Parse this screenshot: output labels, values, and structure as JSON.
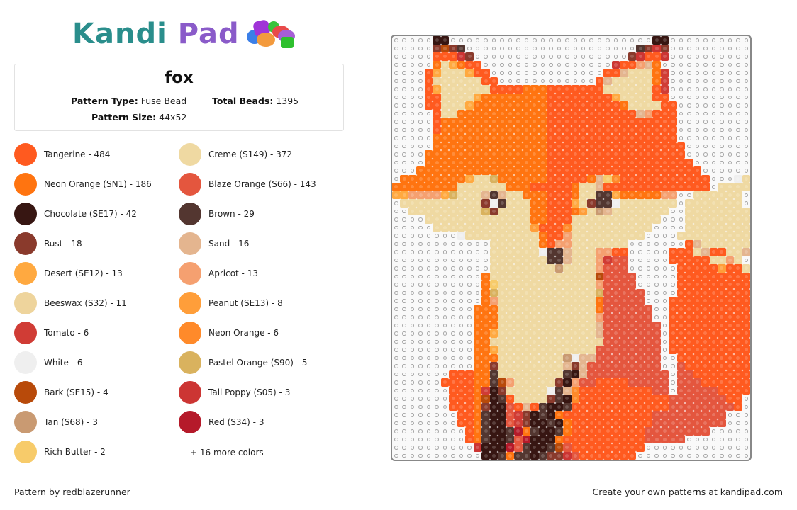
{
  "brand": {
    "part1": "Kandi",
    "part2": "Pad"
  },
  "pattern": {
    "title": "fox",
    "type_label": "Pattern Type:",
    "type_value": "Fuse Bead",
    "beads_label": "Total Beads:",
    "beads_value": "1395",
    "size_label": "Pattern Size:",
    "size_value": "44x52"
  },
  "colors": [
    {
      "name": "Tangerine - 484",
      "hex": "#FF5A1F",
      "code": "T"
    },
    {
      "name": "Creme (S149) - 372",
      "hex": "#EFD9A2",
      "code": "C"
    },
    {
      "name": "Neon Orange (SN1) - 186",
      "hex": "#FF7410",
      "code": "N"
    },
    {
      "name": "Blaze Orange (S66) - 143",
      "hex": "#E4563E",
      "code": "B"
    },
    {
      "name": "Chocolate (SE17) - 42",
      "hex": "#371612",
      "code": "K"
    },
    {
      "name": "Brown - 29",
      "hex": "#533630",
      "code": "W"
    },
    {
      "name": "Rust - 18",
      "hex": "#8A3A2C",
      "code": "R"
    },
    {
      "name": "Sand - 16",
      "hex": "#E4B58F",
      "code": "S"
    },
    {
      "name": "Desert (SE12) - 13",
      "hex": "#FFA940",
      "code": "D"
    },
    {
      "name": "Apricot - 13",
      "hex": "#F5A070",
      "code": "A"
    },
    {
      "name": "Beeswax (S32) - 11",
      "hex": "#EED49C",
      "code": "X"
    },
    {
      "name": "Peanut (SE13) - 8",
      "hex": "#FF9E3A",
      "code": "P"
    },
    {
      "name": "Tomato - 6",
      "hex": "#D03C35",
      "code": "M"
    },
    {
      "name": "Neon Orange - 6",
      "hex": "#FF8A2A",
      "code": "O"
    },
    {
      "name": "White - 6",
      "hex": "#EFEFEF",
      "code": "H"
    },
    {
      "name": "Pastel Orange (S90) - 5",
      "hex": "#D9B25E",
      "code": "L"
    },
    {
      "name": "Bark (SE15) - 4",
      "hex": "#B84A0A",
      "code": "E"
    },
    {
      "name": "Tall Poppy (S05) - 3",
      "hex": "#CC3533",
      "code": "Y"
    },
    {
      "name": "Tan (S68) - 3",
      "hex": "#C99A72",
      "code": "F"
    },
    {
      "name": "Red (S34) - 3",
      "hex": "#B51A2A",
      "code": "Q"
    },
    {
      "name": "Rich Butter - 2",
      "hex": "#F7CB6A",
      "code": "U"
    }
  ],
  "more_colors": "+ 16 more colors",
  "grid": {
    "columns": 44,
    "rows": [
      ".....KK.........................KK..........",
      ".....RERW.....................WRYR..........",
      ".....TTTYR...................RYTTY..........",
      ".....NCDNTT................YTTASN...........",
      "....TDCCCDTT..............TTSCCCNM..........",
      "....TXCCCCCTT............TSCCCCCNM..........",
      "....TDCCCCCCTTTTNNNTTTTTTTCCCCCCTM..........",
      "....TTCCCCDNNNNNNNNTTTTTTTTDCCCCTT..........",
      "....TTCCCDNNNNNNNNNTTTTTTTTTNCCCCTT..........",
      ".....TCCNNNNNNNNNNNTTTTTTTTTTTSATTT.........",
      ".....TNNNNNNNNNNNNNTTTTTTTTTTTTTTTT.........",
      ".....TNNNNNNNNNNNNNTTTTTTTTTTTTTTTT.........",
      ".....NNNNNNNNNNNNNNTTTTTTTTTTTTTTTT.........",
      ".....NNNNNNNNNNNNNNTTTTTTTTTTTTTTTTT........",
      "....NNNNNNNNNNNNNNNTTTTTTTTTTTTTTTTT........",
      "....NNNNNNNNNNNNNNNTTTTTTTTTTTTTTTTTT.......",
      "...NNNNNNNNNNNNNNNNTTTTTTTTTTTTTTTTTTT......",
      ".NNNNNNNNDCCLNNNNNNTTTTTNSUOTTTTTTTTTTT...HC.",
      "NNNNNNNNCCCCCCNNNTTTTTNCCSTTTTTTTTTTTTT.CCCC",
      "DDAAAADLCCCSWSCCNNNTTTNCCWWDNNNNNAA..CCCCCC.",
      ".CCCCCCCCCCRHWCCCNNTTTDCRWWHCCCCCCC.CCCCCCC.",
      "..CCCCCCCCCLRCCCCNNTTTNPCFSCCCCCCC..CCCCCCCC",
      "....CCCCCCCCCCCCCNNTTTCCCCCCCCCCC...CCCCCCCC",
      ".....CCCCCCCCCCCCPTTTOCCCCCCCCCC....CCCCCCCC",
      "........HCCCCCCCCCNTTACCCCCCCCC....CCCCCCCCC",
      "............CCCCCCNTAACCCCCCC.......TSCCCCCC",
      "............CCCCCCHWWSCCCAATT.....TTTCSTTCCS",
      "............CCCCCCCWWSCCCAMBB.....TTTTTCCAC",
      "............CCCCCCCCFCCCCABBB......TTTTTPTTCT",
      "...........NCCCCCCCCCCCCCEBBBB.....TTTTTTTTTT",
      "...........NUCCCCCCCCCCCCABBBB.....TTTTTTTTTT",
      "...........NLCCCCCCCCCCCCLBBBBB....TTTTTTTTTT",
      "...........NACCCCCCCCCCCCNBBBBB...TTTTTTTTTTT",
      "..........NNNCCCCCCCCCCCCNBBBBBB..TTTTTTTTTTT",
      "..........NNNCCCCCCCCCCCCABBBBBB..TTTTTTTTTTT",
      "..........NNNCCCCCCCCCCCCSBBBBBBB.TTTTTTTTTTT",
      "..........NNDCCCCCCCCCCCCSBBBBBBB.TTTTTTTTTTTT",
      "..........NNXCCCCCCCCCCCCXBBBBBBB.TTTTTTTTTTT.",
      "..........NNDCCCCCCCCCCCCBBBBBBBB.TTTTTTTTTTT.",
      "..........NNNCCCCCCCCFHSSBBBBBBBB..TTTTTTTTTT.",
      "..........NNRCCCCCCCCSRSBBBBBBBBB..BTTTTTTTTT.",
      ".......TTTNNWCCCCCCCCWKSBBBBBBBBBB.BBTTTTTTTT.",
      "......TTTTNNWEACCCCCRKABBTTTTBBBBB.BBBTTTTTT..",
      ".......TTTNMKRCCCCCHWSOTTTTTTTTTBB.BBBBBTTTT..",
      ".......TTTNEKWTCCCCRWKOTTTTTTTTTTTBBBBBBBTT...",
      ".......TTTNRKKBTSTWKKWTTTTTTTTTTTTBBBBBBBBT...",
      "........TTNWKKBMRKWKNTTTTTTTTTTTBBBBBBBBB.....",
      "........TTNWKKBMRKKWKNTTTTTTTTTTBBBBBBBBB.....",
      ".........TNWKKWQNWKKWNTTTTTTTTTBBBBBBBB......",
      ".........TNWKKWBQKKKNTTTTTTTTTTBBBBB.........",
      "..........YKKKQBWKKWEBTTTTTTTTT..............",
      "...........KKWNWWKWRRYBTTTTTTT..............."
    ]
  },
  "footer": {
    "left": "Pattern by redblazerunner",
    "right": "Create your own patterns at kandipad.com"
  }
}
